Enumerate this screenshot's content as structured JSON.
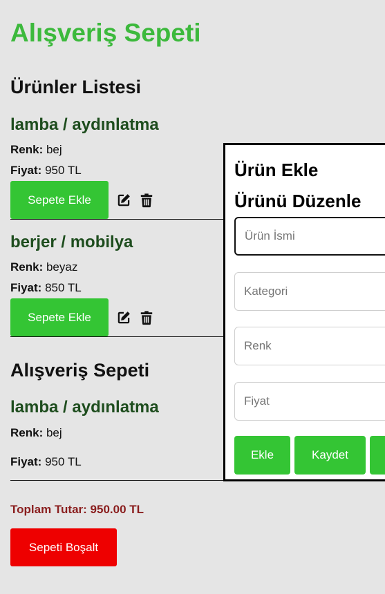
{
  "app": {
    "title": "Alışveriş Sepeti"
  },
  "colors": {
    "accent_green": "#34c534",
    "title_green": "#3cb93c",
    "product_green": "#1e4d1e",
    "danger_red": "#ee0000",
    "total_red": "#8a1e1e"
  },
  "products_section": {
    "title": "Ürünler Listesi",
    "items": [
      {
        "name": "lamba / aydınlatma",
        "color_label": "Renk:",
        "color_value": "bej",
        "price_label": "Fiyat:",
        "price_value": "950 TL",
        "add_button": "Sepete Ekle",
        "edit_icon": "edit-icon",
        "delete_icon": "trash-icon"
      },
      {
        "name": "berjer / mobilya",
        "color_label": "Renk:",
        "color_value": "beyaz",
        "price_label": "Fiyat:",
        "price_value": "850 TL",
        "add_button": "Sepete Ekle",
        "edit_icon": "edit-icon",
        "delete_icon": "trash-icon"
      }
    ]
  },
  "cart_section": {
    "title": "Alışveriş Sepeti",
    "items": [
      {
        "name": "lamba / aydınlatma",
        "color_label": "Renk:",
        "color_value": "bej",
        "price_label": "Fiyat:",
        "price_value": "950 TL"
      }
    ],
    "total_label": "Toplam Tutar:",
    "total_value": "950.00 TL",
    "empty_button": "Sepeti Boşalt"
  },
  "form_panel": {
    "add_title": "Ürün Ekle",
    "edit_title": "Ürünü Düzenle",
    "fields": {
      "name_placeholder": "Ürün İsmi",
      "category_placeholder": "Kategori",
      "color_placeholder": "Renk",
      "price_placeholder": "Fiyat"
    },
    "buttons": {
      "add": "Ekle",
      "save": "Kaydet"
    }
  }
}
